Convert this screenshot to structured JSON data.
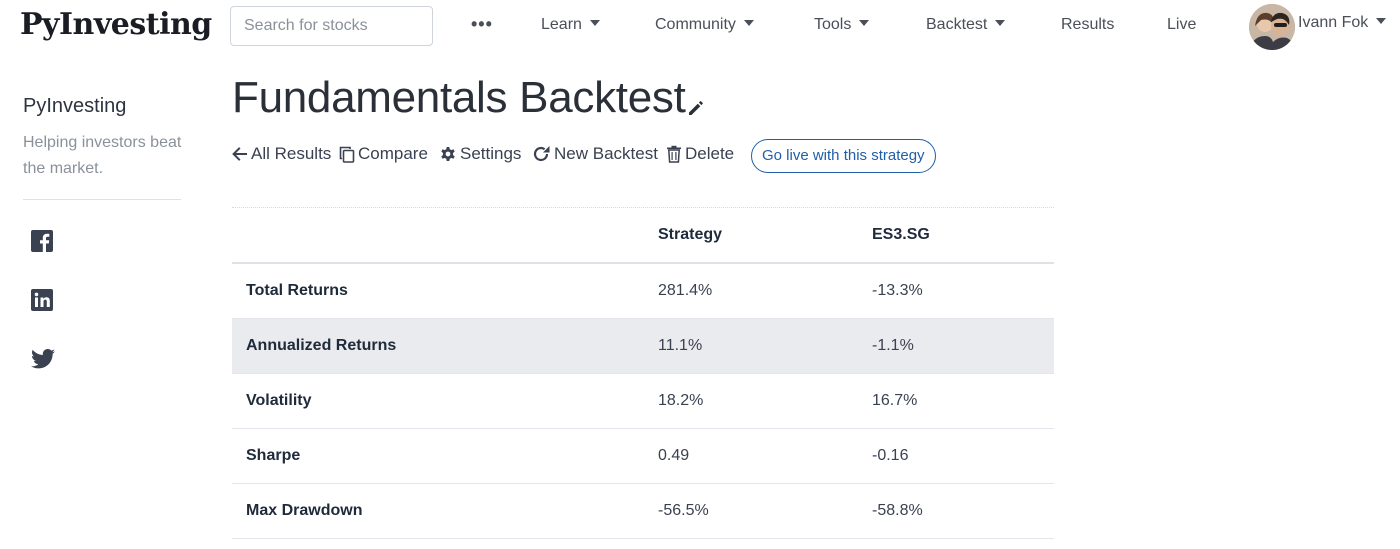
{
  "navbar": {
    "brand": "PyInvesting",
    "search_placeholder": "Search for stocks",
    "more_label": "•••",
    "items": [
      {
        "label": "Learn",
        "dropdown": true
      },
      {
        "label": "Community",
        "dropdown": true
      },
      {
        "label": "Tools",
        "dropdown": true
      },
      {
        "label": "Backtest",
        "dropdown": true
      },
      {
        "label": "Results",
        "dropdown": false
      },
      {
        "label": "Live",
        "dropdown": false
      }
    ],
    "user_name": "Ivann Fok"
  },
  "sidebar": {
    "title": "PyInvesting",
    "tagline": "Helping investors beat the market.",
    "social": [
      "facebook-icon",
      "linkedin-icon",
      "twitter-icon"
    ]
  },
  "main": {
    "title": "Fundamentals Backtest",
    "actions": [
      {
        "label": "All Results",
        "icon": "arrow-left-icon"
      },
      {
        "label": "Compare",
        "icon": "copy-icon"
      },
      {
        "label": "Settings",
        "icon": "gear-icon"
      },
      {
        "label": "New Backtest",
        "icon": "redo-icon"
      },
      {
        "label": "Delete",
        "icon": "trash-icon"
      }
    ],
    "go_live_label": "Go live with this strategy",
    "table": {
      "headers": [
        "",
        "Strategy",
        "ES3.SG"
      ],
      "rows": [
        {
          "metric": "Total Returns",
          "strategy": "281.4%",
          "benchmark": "-13.3%"
        },
        {
          "metric": "Annualized Returns",
          "strategy": "11.1%",
          "benchmark": "-1.1%"
        },
        {
          "metric": "Volatility",
          "strategy": "18.2%",
          "benchmark": "16.7%"
        },
        {
          "metric": "Sharpe",
          "strategy": "0.49",
          "benchmark": "-0.16"
        },
        {
          "metric": "Max Drawdown",
          "strategy": "-56.5%",
          "benchmark": "-58.8%"
        }
      ],
      "highlighted_row": 1
    }
  },
  "colors": {
    "accent": "#1f5fa8",
    "text": "#1f2a3a",
    "muted": "#8a919a",
    "row_highlight": "#e9ebee"
  }
}
